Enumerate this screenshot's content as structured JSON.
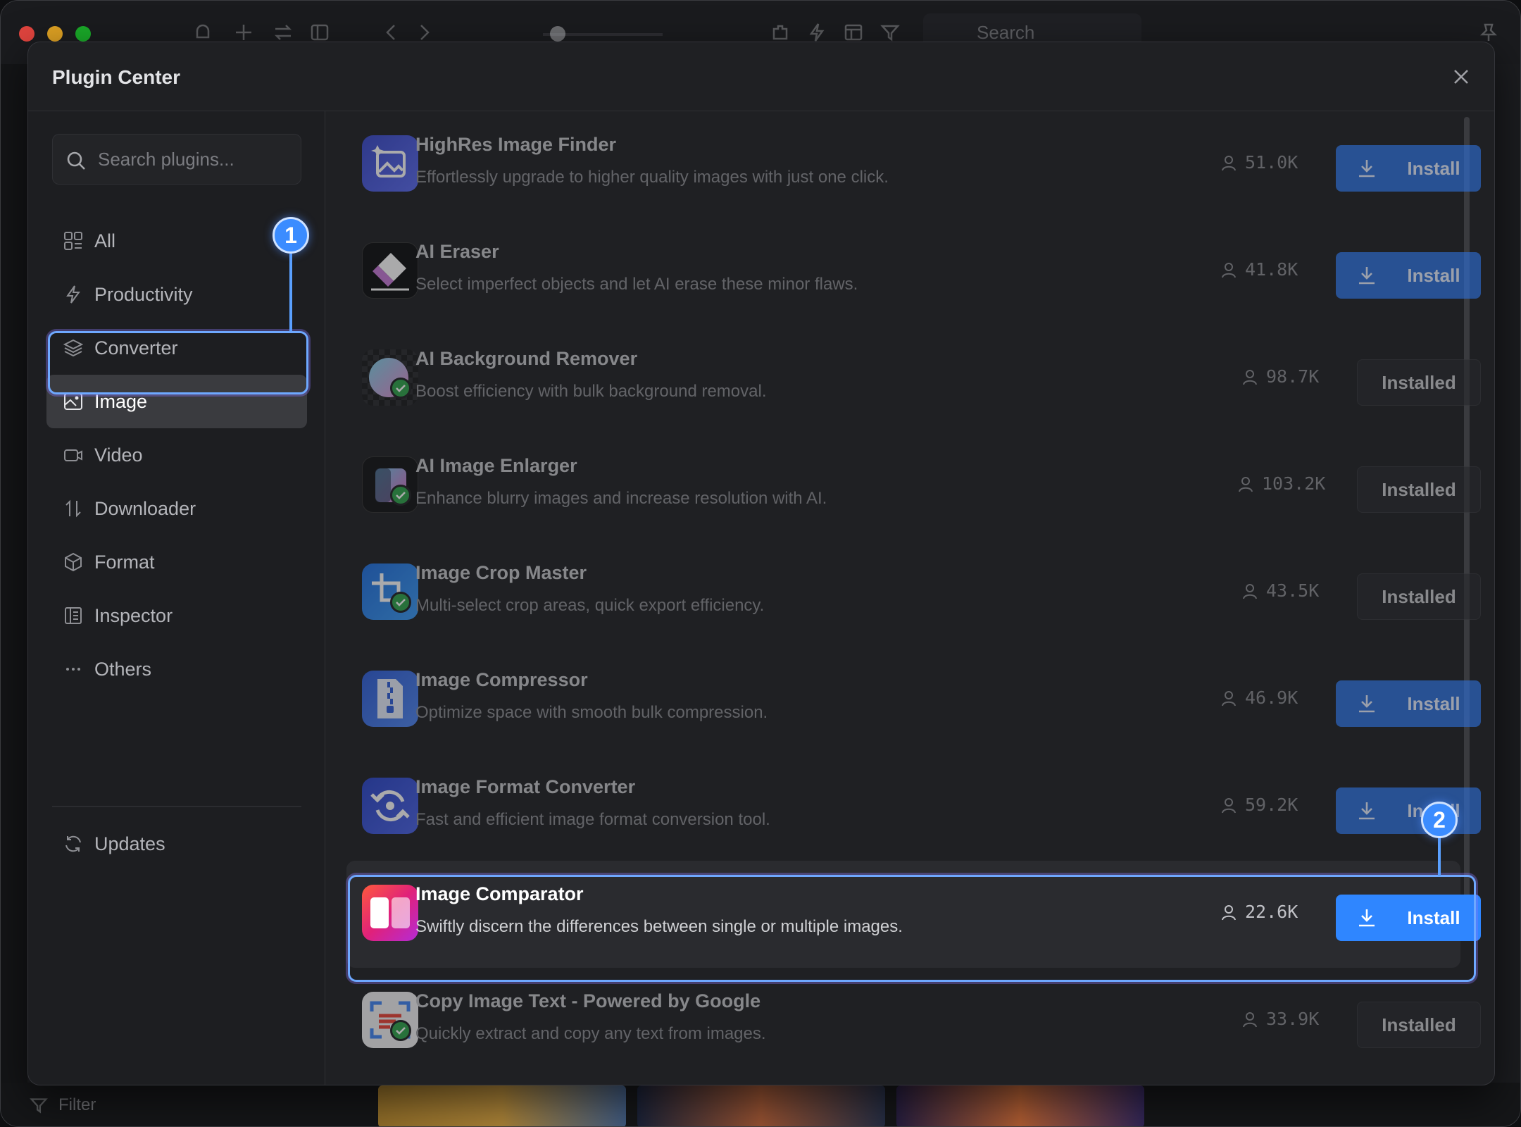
{
  "window": {
    "traffic_lights": [
      "#e0443e",
      "#dea123",
      "#1aab29"
    ]
  },
  "toolbar": {
    "search_placeholder": "Search",
    "filter_label": "Filter"
  },
  "modal": {
    "title": "Plugin Center"
  },
  "sidebar": {
    "search_placeholder": "Search plugins...",
    "items": [
      {
        "label": "All",
        "icon": "grid-icon"
      },
      {
        "label": "Productivity",
        "icon": "bolt-icon"
      },
      {
        "label": "Converter",
        "icon": "layers-icon"
      },
      {
        "label": "Image",
        "icon": "image-icon",
        "active": true
      },
      {
        "label": "Video",
        "icon": "video-icon"
      },
      {
        "label": "Downloader",
        "icon": "arrows-updown-icon"
      },
      {
        "label": "Format",
        "icon": "cube-icon"
      },
      {
        "label": "Inspector",
        "icon": "inspector-icon"
      },
      {
        "label": "Others",
        "icon": "ellipsis-icon"
      }
    ],
    "updates_label": "Updates"
  },
  "annotations": {
    "badge1": "1",
    "badge2": "2"
  },
  "plugins": [
    {
      "name": "HighRes Image Finder",
      "desc": "Effortlessly upgrade to higher quality images with just one click.",
      "downloads": "51.0K",
      "action": "Install"
    },
    {
      "name": "AI Eraser",
      "desc": "Select imperfect objects and let AI erase these minor flaws.",
      "downloads": "41.8K",
      "action": "Install"
    },
    {
      "name": "AI Background Remover",
      "desc": "Boost efficiency with bulk background removal.",
      "downloads": "98.7K",
      "action": "Installed"
    },
    {
      "name": "AI Image Enlarger",
      "desc": "Enhance blurry images and increase resolution with AI.",
      "downloads": "103.2K",
      "action": "Installed"
    },
    {
      "name": "Image Crop Master",
      "desc": "Multi-select crop areas, quick export efficiency.",
      "downloads": "43.5K",
      "action": "Installed"
    },
    {
      "name": "Image Compressor",
      "desc": "Optimize space with smooth bulk compression.",
      "downloads": "46.9K",
      "action": "Install"
    },
    {
      "name": "Image Format Converter",
      "desc": "Fast and efficient image format conversion tool.",
      "downloads": "59.2K",
      "action": "Install"
    },
    {
      "name": "Image Comparator",
      "desc": "Swiftly discern the differences between single or multiple images.",
      "downloads": "22.6K",
      "action": "Install",
      "highlighted": true
    },
    {
      "name": "Copy Image Text - Powered by Google",
      "desc": "Quickly extract and copy any text from images.",
      "downloads": "33.9K",
      "action": "Installed"
    }
  ],
  "colors": {
    "accent": "#2f86ff",
    "annotation": "#6ea8ff",
    "installed_check": "#2fa34a"
  }
}
